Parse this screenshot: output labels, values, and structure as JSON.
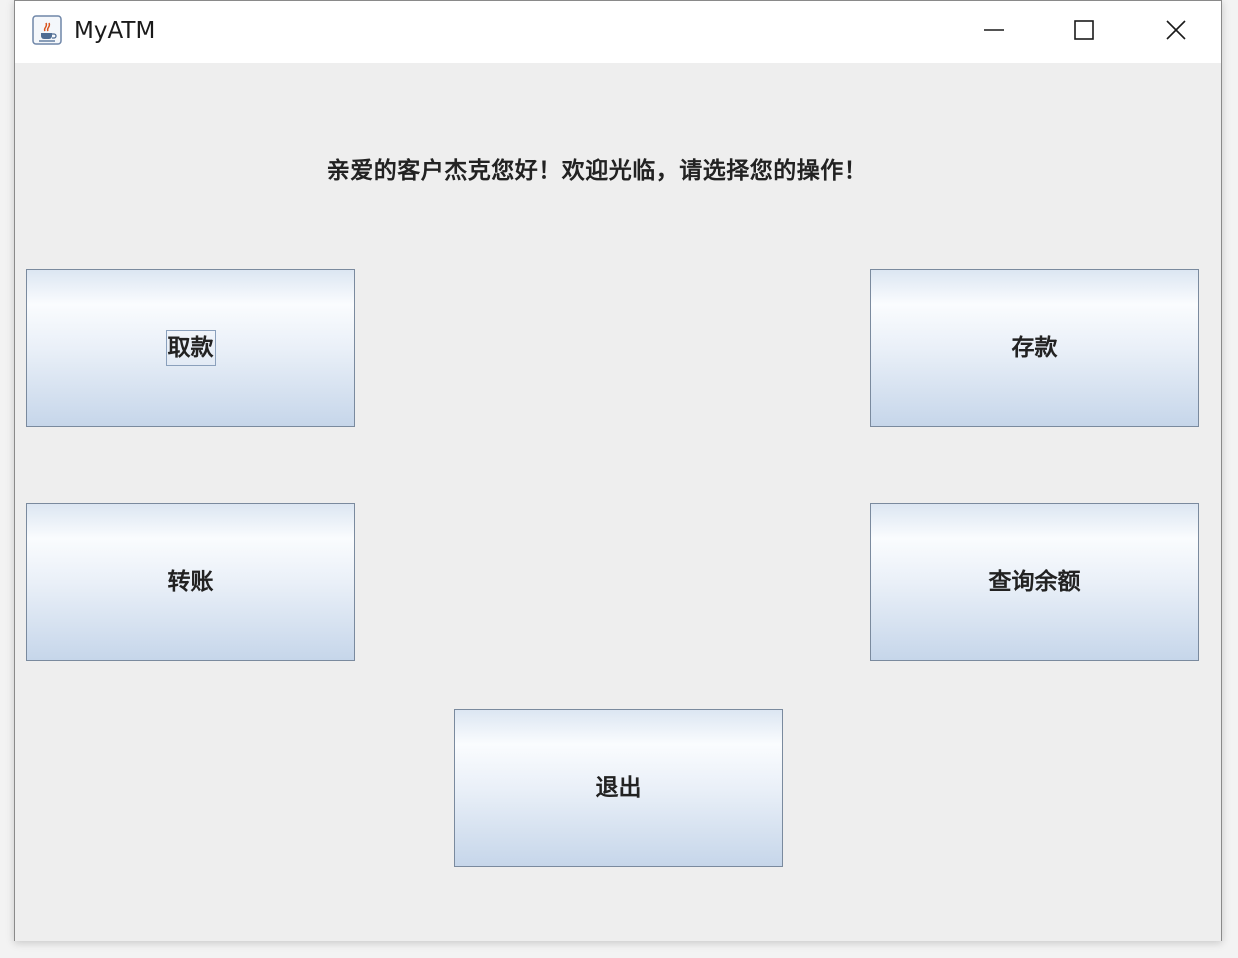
{
  "window": {
    "title": "MyATM",
    "app_icon": "java-coffee-cup-icon"
  },
  "title_controls": {
    "minimize_icon": "minimize-icon",
    "maximize_icon": "maximize-icon",
    "close_icon": "close-icon"
  },
  "main": {
    "welcome_message": "亲爱的客户杰克您好！欢迎光临，请选择您的操作！",
    "buttons": {
      "withdraw": "取款",
      "deposit": "存款",
      "transfer": "转账",
      "balance": "查询余额",
      "exit": "退出"
    },
    "focused_button": "取款"
  },
  "colors": {
    "titlebar_bg": "#ffffff",
    "client_bg": "#eeeeee",
    "button_gradient_top": "#fafcfe",
    "button_gradient_bottom": "#c6d6ea",
    "button_border": "#7a8a9e"
  }
}
